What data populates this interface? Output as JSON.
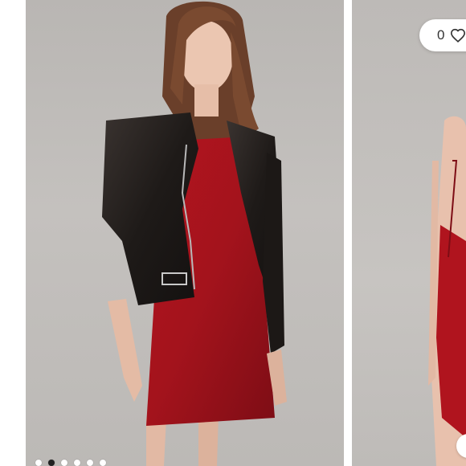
{
  "carousel": {
    "slides": [
      {
        "name": "model-front-view",
        "alt": ""
      },
      {
        "name": "model-back-view",
        "alt": ""
      }
    ],
    "active_index": 1,
    "dot_count": 6
  },
  "like": {
    "count": "0",
    "icon": "heart-outline-icon"
  },
  "colors": {
    "dress": "#a3131c",
    "jacket": "#1e1a18",
    "background": "#c0bdba"
  }
}
